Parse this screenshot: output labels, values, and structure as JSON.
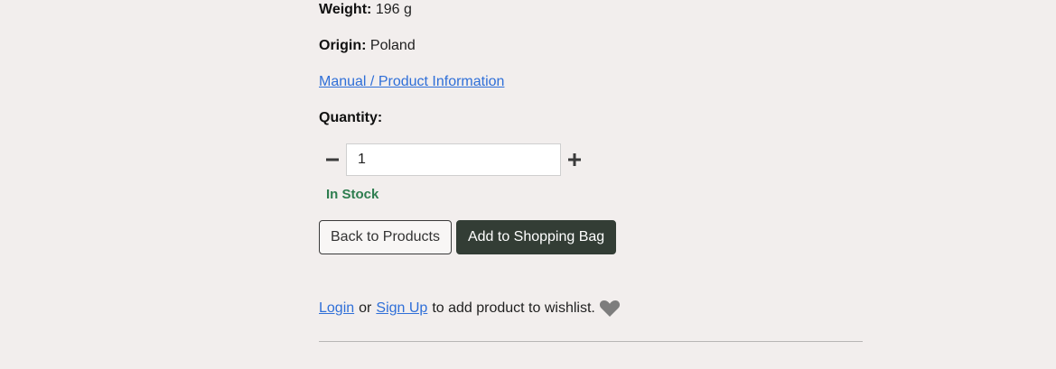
{
  "product": {
    "weight_label": "Weight:",
    "weight_value": "196 g",
    "origin_label": "Origin:",
    "origin_value": "Poland",
    "manual_link": "Manual / Product Information"
  },
  "quantity": {
    "label": "Quantity:",
    "value": "1",
    "decrement_icon": "minus-icon",
    "increment_icon": "plus-icon"
  },
  "stock": {
    "status": "In Stock",
    "color": "#2e7d4f"
  },
  "actions": {
    "back_label": "Back to Products",
    "add_label": "Add to Shopping Bag",
    "add_color": "#333d35"
  },
  "wishlist": {
    "login_label": "Login",
    "or_text": "or",
    "signup_label": "Sign Up",
    "suffix_text": "to add product to wishlist.",
    "icon": "heart-icon"
  },
  "colors": {
    "background": "#f2eeed",
    "link": "#2f6fd8"
  }
}
